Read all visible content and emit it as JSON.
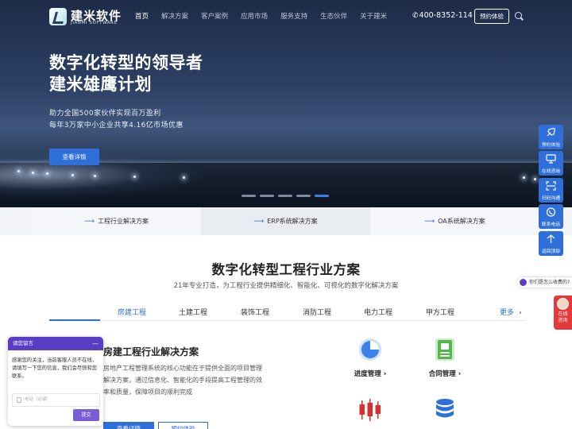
{
  "brand": {
    "name_cn": "建米软件",
    "name_en": "JIANMI SOFTWARE"
  },
  "nav": {
    "items": [
      {
        "label": "首页",
        "active": true
      },
      {
        "label": "解决方案",
        "active": false
      },
      {
        "label": "客户案例",
        "active": false
      },
      {
        "label": "应用市场",
        "active": false
      },
      {
        "label": "服务支持",
        "active": false
      },
      {
        "label": "生态伙伴",
        "active": false
      },
      {
        "label": "关于建米",
        "active": false
      }
    ],
    "phone": "400-8352-114",
    "trial_button": "预约体验"
  },
  "hero": {
    "title_line1": "数字化转型的领导者",
    "title_line2": "建米雄鹰计划",
    "sub_line1": "助力全国500家伙伴实现百万盈利",
    "sub_line2": "每年3万家中小企业共享4.16亿市场优惠",
    "button": "查看详情",
    "carousel_count": 5,
    "carousel_active": 5
  },
  "solutions_bar": [
    {
      "label": "工程行业解决方案"
    },
    {
      "label": "ERP系统解决方案"
    },
    {
      "label": "OA系统解决方案"
    }
  ],
  "section": {
    "title": "数字化转型工程行业方案",
    "subtitle": "21年专业打造，为工程行业提供精细化、智能化、可视化的数字化解决方案",
    "tabs": [
      "房建工程",
      "土建工程",
      "装饰工程",
      "消防工程",
      "电力工程",
      "甲方工程"
    ],
    "active_tab": "房建工程",
    "more": "更多",
    "solution_title": "房建工程行业解决方案",
    "solution_desc": "房地产工程管理系统的核心功能在于提供全面的项目管理解决方案，通过信息化、智能化的手段提高工程管理的效率和质量，保障项目的顺利完成",
    "btn_detail": "查看详情",
    "btn_demo": "预约体验",
    "features": [
      {
        "label": "进度管理",
        "icon": "progress-pie-icon",
        "color": "#3b82e8"
      },
      {
        "label": "合同管理",
        "icon": "contract-doc-icon",
        "color": "#52b84a"
      },
      {
        "label": "",
        "icon": "candlestick-icon",
        "color": "#d9302f"
      },
      {
        "label": "",
        "icon": "database-icon",
        "color": "#2f6fd9"
      }
    ]
  },
  "float_bar": [
    {
      "label": "预约体验",
      "icon": "rocket-icon"
    },
    {
      "label": "在线咨询",
      "icon": "chat-monitor-icon"
    },
    {
      "label": "扫码沟通",
      "icon": "qr-scan-icon"
    },
    {
      "label": "联系电话",
      "icon": "phone-icon"
    },
    {
      "label": "返回顶部",
      "icon": "arrow-up-icon"
    }
  ],
  "consult_chip": "你们是怎么收费的?",
  "avatar_card": {
    "line1": "在线",
    "line2": "咨询"
  },
  "chat": {
    "header": "请您留言",
    "minimize": "—",
    "message": "感谢您的关注，当前客服人员不在线，请填写一下您的信息，我们会尽快和您联系。",
    "phone_placeholder": "电话（必填）",
    "send": "提交"
  },
  "colors": {
    "accent": "#2f6fd9",
    "chat_purple": "#5b3cc4",
    "red": "#e5383b"
  }
}
